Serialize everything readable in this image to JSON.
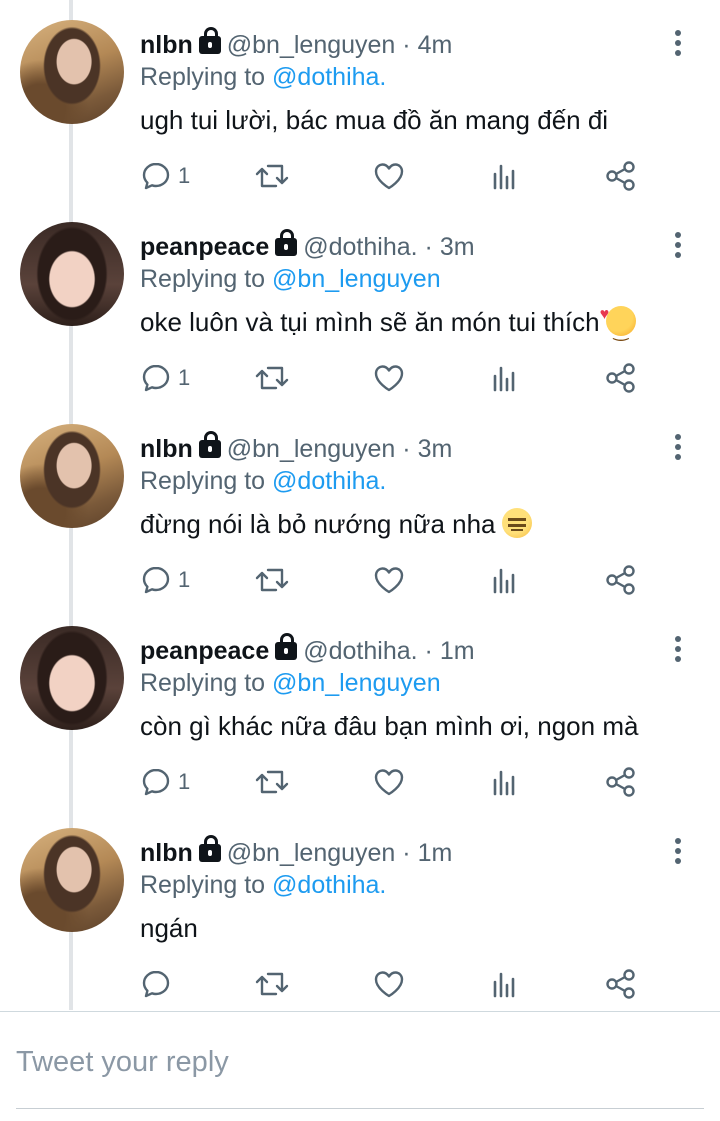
{
  "tweets": [
    {
      "name": "nlbn",
      "handle": "@bn_lenguyen",
      "dot": "·",
      "time": "4m",
      "replying_prefix": "Replying to",
      "replying_to": "@dothiha.",
      "text": "ugh tui lười, bác mua đồ ăn mang đến đi",
      "emoji": "",
      "reply_count": "1",
      "avatar": "avatar-nlbn"
    },
    {
      "name": "peanpeace",
      "handle": "@dothiha.",
      "dot": "·",
      "time": "3m",
      "replying_prefix": "Replying to",
      "replying_to": "@bn_lenguyen",
      "text": "oke luôn và tụi mình sẽ ăn món tui thích",
      "emoji": "smiling-face-with-hearts",
      "reply_count": "1",
      "avatar": "avatar-peanpeace"
    },
    {
      "name": "nlbn",
      "handle": "@bn_lenguyen",
      "dot": "·",
      "time": "3m",
      "replying_prefix": "Replying to",
      "replying_to": "@dothiha.",
      "text": "đừng nói là bỏ nướng nữa nha",
      "emoji": "expressionless-face",
      "reply_count": "1",
      "avatar": "avatar-nlbn"
    },
    {
      "name": "peanpeace",
      "handle": "@dothiha.",
      "dot": "·",
      "time": "1m",
      "replying_prefix": "Replying to",
      "replying_to": "@bn_lenguyen",
      "text": "còn gì khác nữa đâu bạn mình ơi, ngon mà",
      "emoji": "",
      "reply_count": "1",
      "avatar": "avatar-peanpeace"
    },
    {
      "name": "nlbn",
      "handle": "@bn_lenguyen",
      "dot": "·",
      "time": "1m",
      "replying_prefix": "Replying to",
      "replying_to": "@dothiha.",
      "text": "ngán",
      "emoji": "",
      "reply_count": "",
      "avatar": "avatar-nlbn"
    }
  ],
  "icons": {
    "reply": "reply-icon",
    "retweet": "retweet-icon",
    "like": "like-icon",
    "views": "views-icon",
    "share": "share-icon",
    "more": "more-icon",
    "lock": "lock-icon"
  },
  "composer": {
    "placeholder": "Tweet your reply"
  },
  "colors": {
    "link": "#1d9bf0",
    "muted": "#536471",
    "text": "#0f1419"
  }
}
